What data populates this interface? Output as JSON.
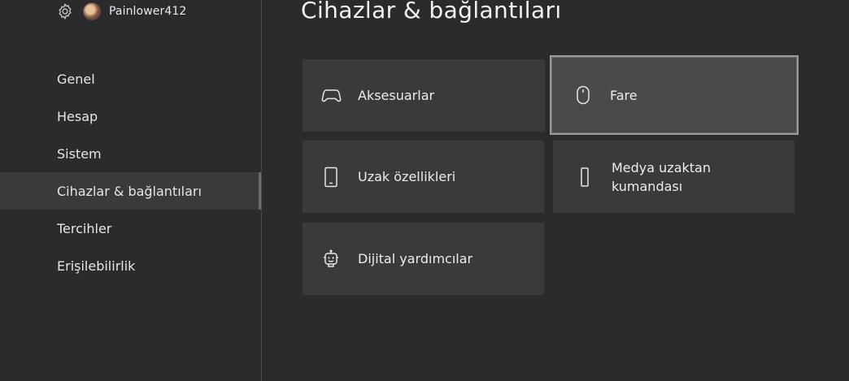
{
  "header": {
    "username": "Painlower412"
  },
  "sidebar": {
    "items": [
      {
        "label": "Genel"
      },
      {
        "label": "Hesap"
      },
      {
        "label": "Sistem"
      },
      {
        "label": "Cihazlar & bağlantıları",
        "active": true
      },
      {
        "label": "Tercihler"
      },
      {
        "label": "Erişilebilirlik"
      }
    ]
  },
  "main": {
    "title": "Cihazlar & bağlantıları",
    "tiles": [
      {
        "label": "Aksesuarlar",
        "icon": "gamepad-icon"
      },
      {
        "label": "Fare",
        "icon": "mouse-icon",
        "focused": true
      },
      {
        "label": "Uzak özellikleri",
        "icon": "phone-icon"
      },
      {
        "label": "Medya uzaktan kumandası",
        "icon": "remote-icon"
      },
      {
        "label": "Dijital yardımcılar",
        "icon": "assistant-bot-icon"
      }
    ]
  },
  "colors": {
    "background": "#2b2a2d",
    "tile": "#3a393c",
    "tile_focused": "#4a494c",
    "text": "#ececec"
  }
}
